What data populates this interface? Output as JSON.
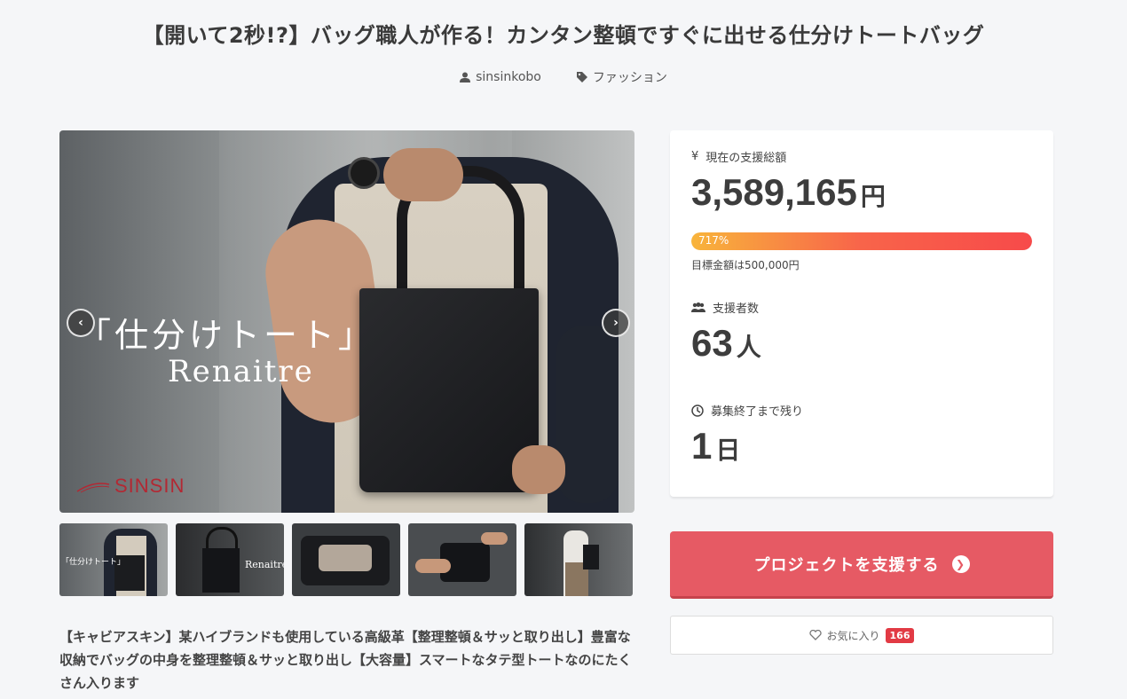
{
  "project": {
    "title": "【開いて2秒!?】バッグ職人が作る！カンタン整頓ですぐに出せる仕分けトートバッグ",
    "author": "sinsinkobo",
    "category": "ファッション"
  },
  "hero": {
    "overlay_jp": "「仕分けトート」",
    "overlay_en": "Renaitre",
    "brand": "SINSIN",
    "prev_label": "‹",
    "next_label": "›"
  },
  "thumbnails": [
    {
      "label": "「仕分けトート」"
    },
    {
      "label": "Renaitre"
    },
    {
      "label": ""
    },
    {
      "label": ""
    },
    {
      "label": ""
    }
  ],
  "description": "【キャビアスキン】某ハイブランドも使用している高級革【整理整頓＆サッと取り出し】豊富な収納でバッグの中身を整理整頓＆サッと取り出し【大容量】スマートなタテ型トートなのにたくさん入ります",
  "stats": {
    "total_label": "現在の支援総額",
    "total_amount": "3,589,165",
    "total_unit": "円",
    "progress_percent": 717,
    "progress_label": "717%",
    "goal_text": "目標金額は500,000円",
    "backers_label": "支援者数",
    "backers_count": "63",
    "backers_unit": "人",
    "remaining_label": "募集終了まで残り",
    "remaining_count": "1",
    "remaining_unit": "日"
  },
  "actions": {
    "support_label": "プロジェクトを支援する",
    "favorite_label": "お気に入り",
    "favorite_count": "166"
  },
  "colors": {
    "primary": "#e65a64",
    "badge": "#e23a44",
    "progress_start": "#f8b43b",
    "progress_end": "#f74a4a"
  }
}
